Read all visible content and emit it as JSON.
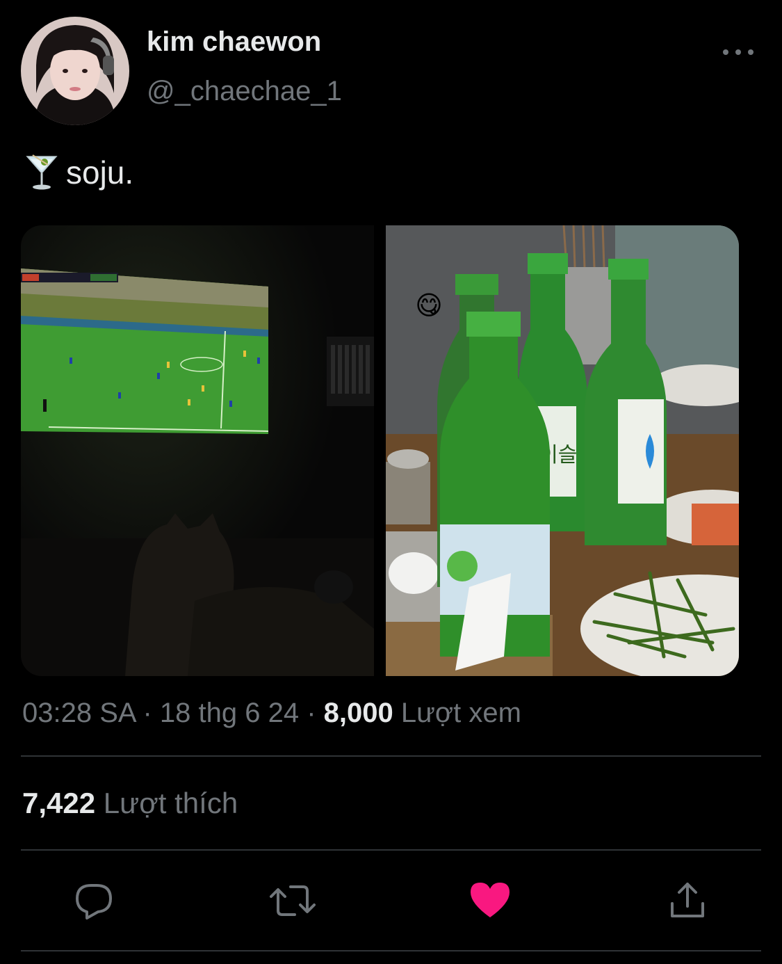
{
  "author": {
    "display_name": "kim chaewon",
    "handle": "@_chaechae_1"
  },
  "tweet": {
    "emoji": "🍸",
    "text": "soju."
  },
  "media": [
    {
      "icon": "football-on-tv-photo"
    },
    {
      "icon": "soju-bottles-photo",
      "sticker": "😋"
    }
  ],
  "meta": {
    "time": "03:28 SA",
    "separator": " · ",
    "date": "18 thg 6 24",
    "views_count": "8,000",
    "views_label": "Lượt xem"
  },
  "stats": {
    "likes_count": "7,422",
    "likes_label": "Lượt thích"
  },
  "actions": [
    {
      "name": "reply",
      "icon": "reply-icon"
    },
    {
      "name": "retweet",
      "icon": "retweet-icon"
    },
    {
      "name": "like",
      "icon": "heart-icon",
      "active": true
    },
    {
      "name": "share",
      "icon": "share-icon"
    }
  ],
  "colors": {
    "background": "#000000",
    "primary_text": "#e7e9ea",
    "secondary_text": "#71767b",
    "divider": "#2f3336",
    "like_active": "#f91880"
  }
}
